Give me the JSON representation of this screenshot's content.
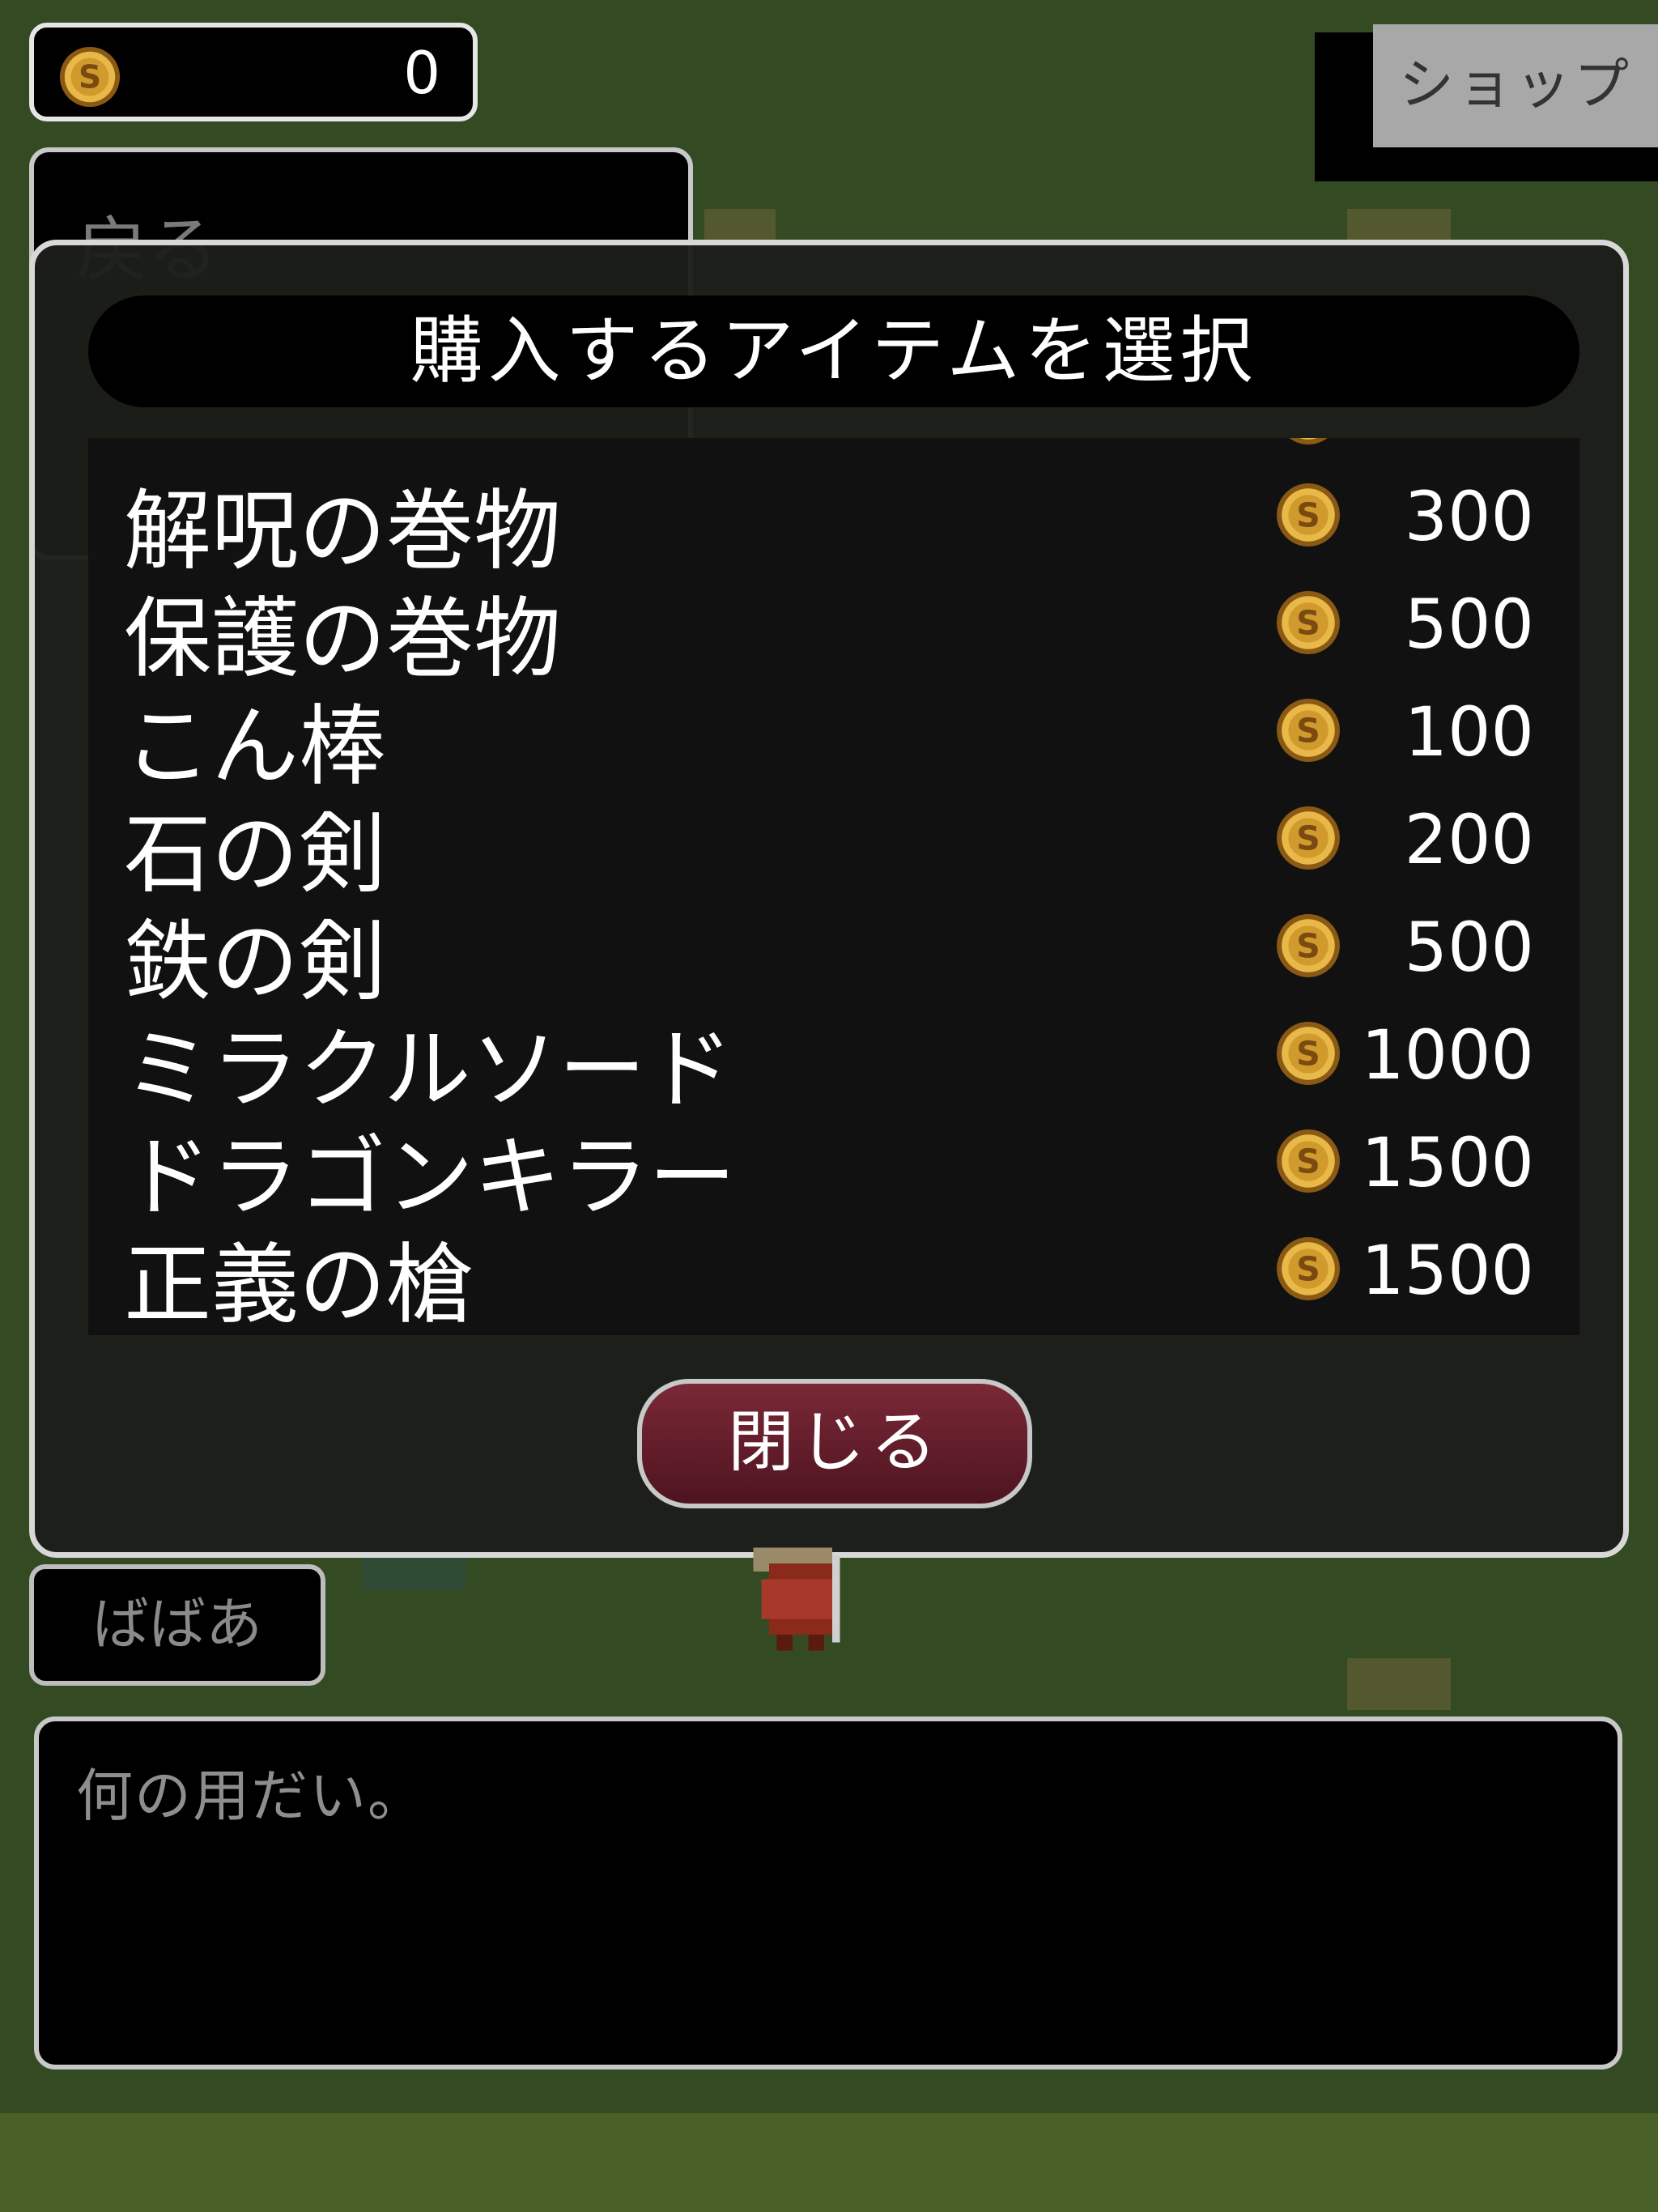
{
  "hud": {
    "coins": "0",
    "shop_tab_label": "ショップ"
  },
  "menu": {
    "back_label": "戻る"
  },
  "shop_modal": {
    "title": "購入するアイテムを選択",
    "items": [
      {
        "name": "解呪の巻物",
        "price": "300"
      },
      {
        "name": "保護の巻物",
        "price": "500"
      },
      {
        "name": "こん棒",
        "price": "100"
      },
      {
        "name": "石の剣",
        "price": "200"
      },
      {
        "name": "鉄の剣",
        "price": "500"
      },
      {
        "name": "ミラクルソード",
        "price": "1000"
      },
      {
        "name": "ドラゴンキラー",
        "price": "1500"
      },
      {
        "name": "正義の槍",
        "price": "1500"
      }
    ],
    "close_label": "閉じる"
  },
  "dialog": {
    "speaker": "ばばあ",
    "message": "何の用だい。"
  },
  "colors": {
    "field": "#344a22",
    "coin_gold": "#d8a636",
    "close_button": "#6a1e2c"
  },
  "icons": {
    "coin": "gold-coin-icon",
    "npc": "old-woman-sprite"
  }
}
